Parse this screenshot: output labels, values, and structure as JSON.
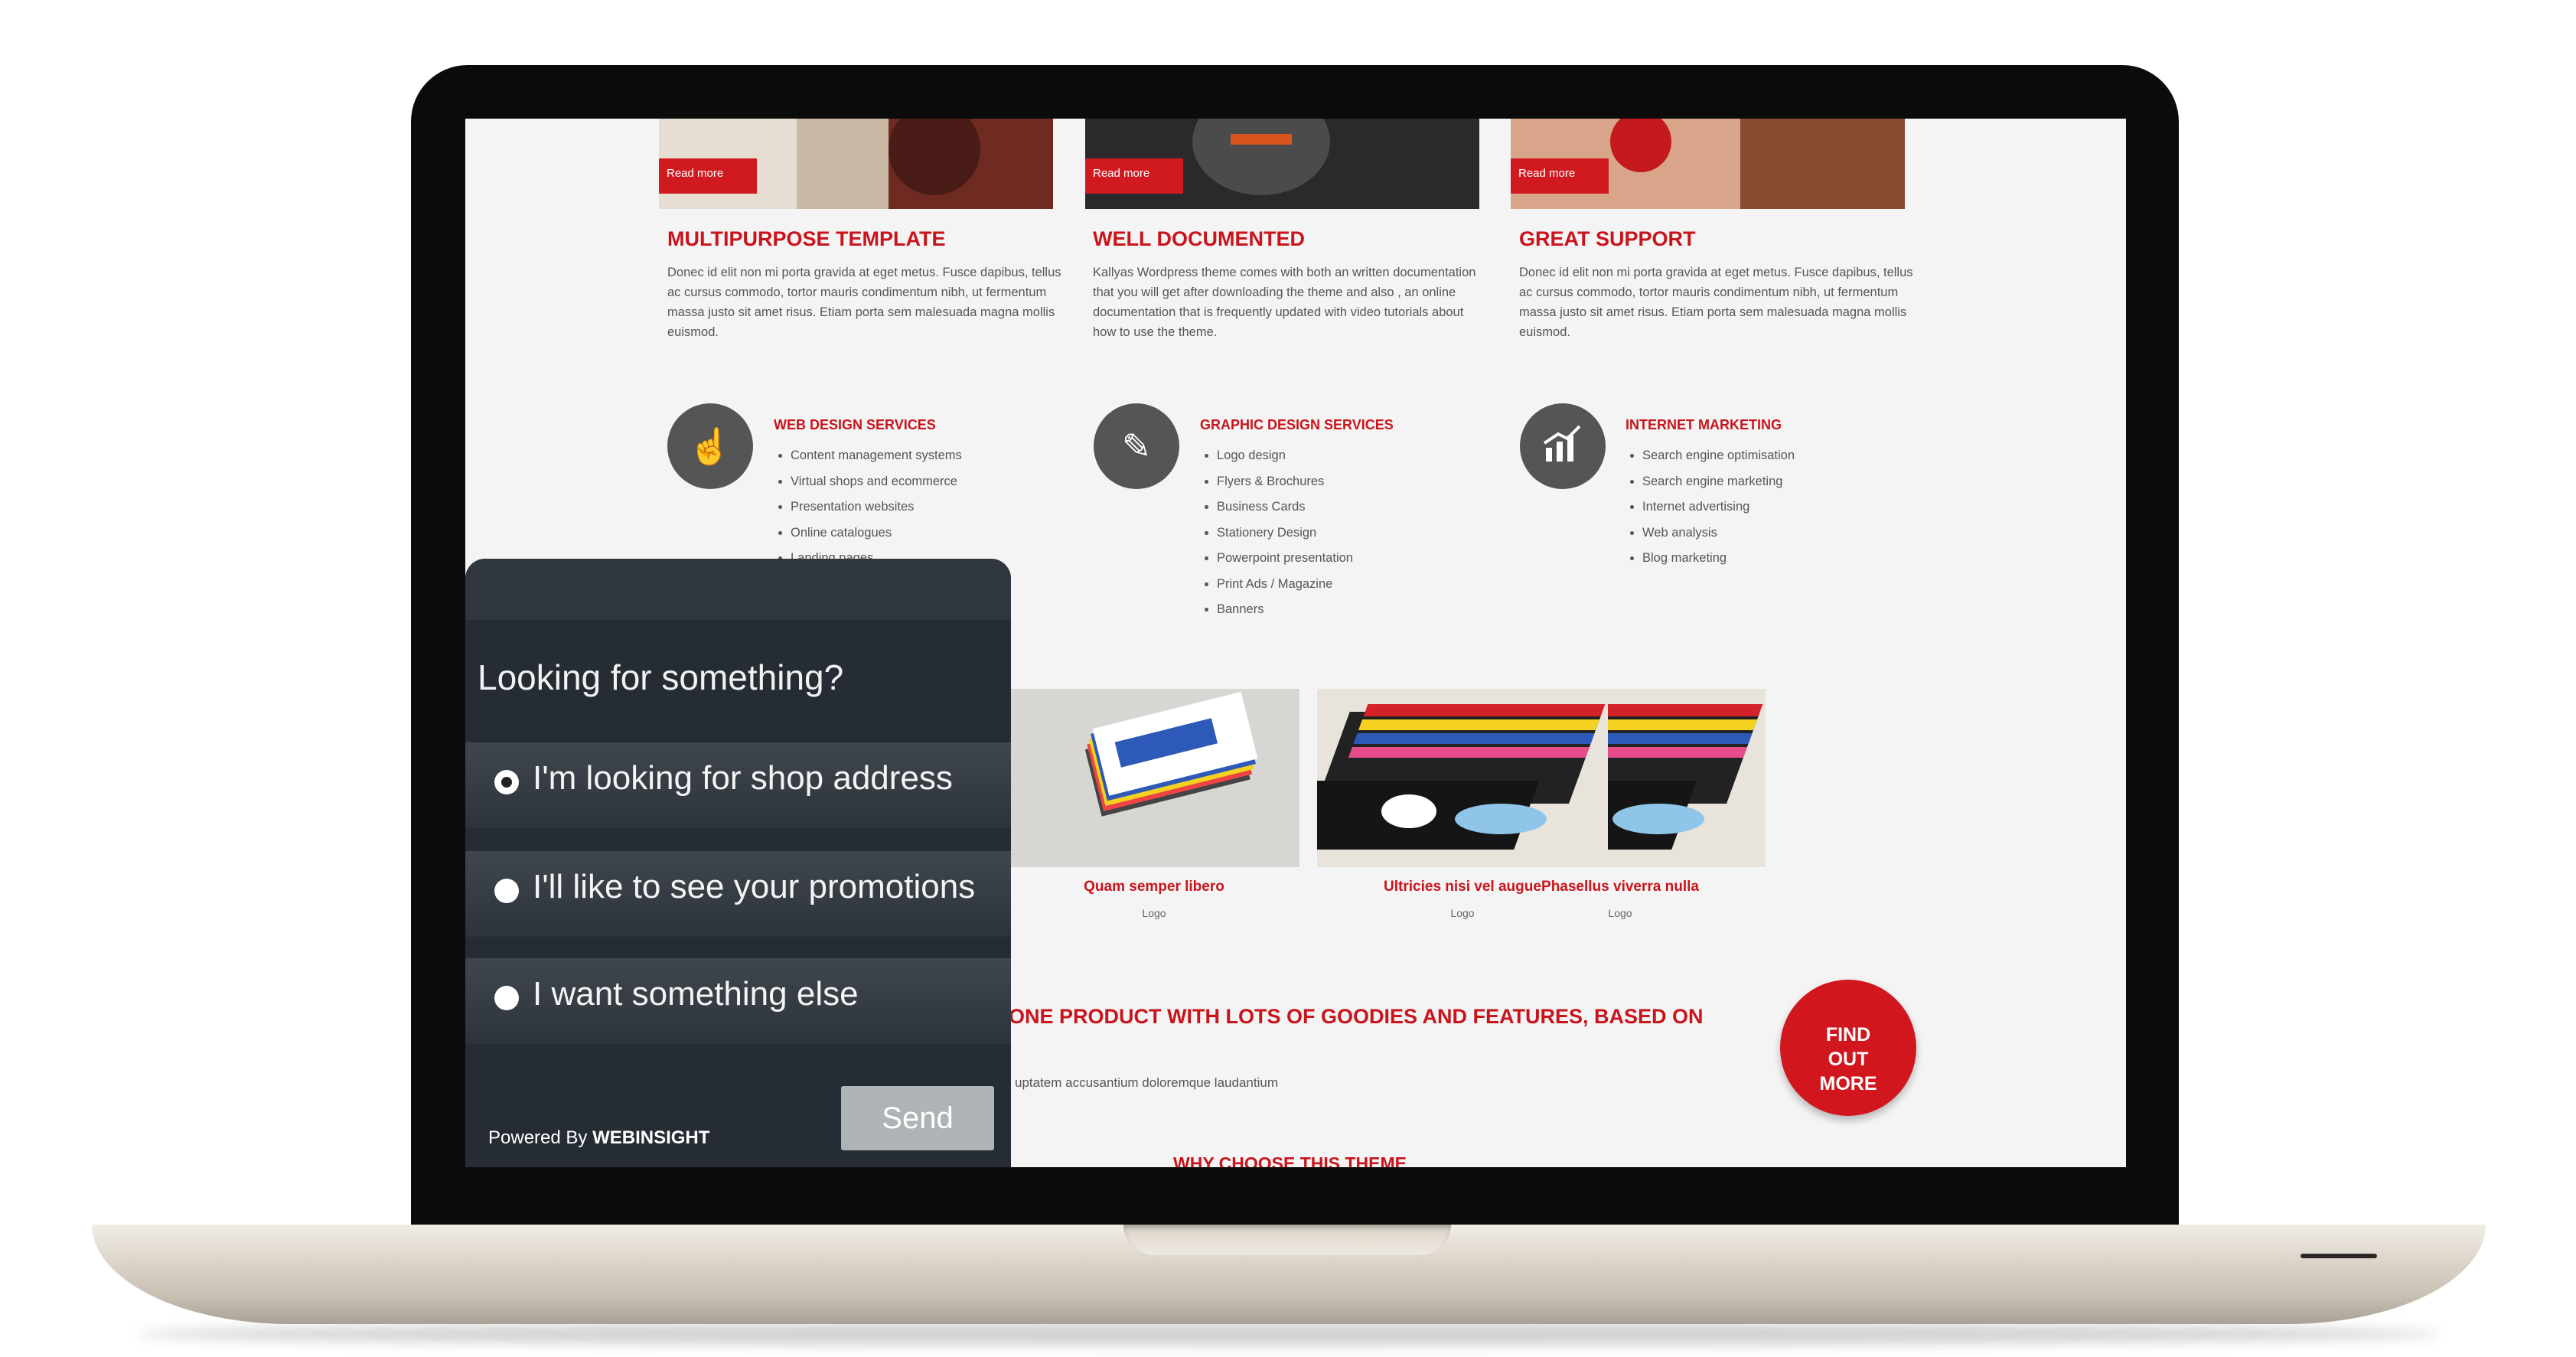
{
  "features": [
    {
      "read_more": "Read more",
      "title": "MULTIPURPOSE TEMPLATE",
      "text": "Donec id elit non mi porta gravida at eget metus. Fusce dapibus, tellus ac cursus commodo, tortor mauris condimentum nibh, ut fermentum massa justo sit amet risus. Etiam porta sem malesuada magna mollis euismod."
    },
    {
      "read_more": "Read more",
      "title": "WELL DOCUMENTED",
      "text": "Kallyas Wordpress theme comes with both an written documentation that you will get after downloading the theme and also , an online documentation that is frequently updated with video tutorials about how to use the theme."
    },
    {
      "read_more": "Read more",
      "title": "GREAT SUPPORT",
      "text": "Donec id elit non mi porta gravida at eget metus. Fusce dapibus, tellus ac cursus commodo, tortor mauris condimentum nibh, ut fermentum massa justo sit amet risus. Etiam porta sem malesuada magna mollis euismod."
    }
  ],
  "services": [
    {
      "icon": "hand-pointer-icon",
      "title": "WEB DESIGN SERVICES",
      "items": [
        "Content management systems",
        "Virtual shops and ecommerce",
        "Presentation websites",
        "Online catalogues",
        "Landing pages"
      ]
    },
    {
      "icon": "paintbrush-icon",
      "title": "GRAPHIC DESIGN SERVICES",
      "items": [
        "Logo design",
        "Flyers & Brochures",
        "Business Cards",
        "Stationery Design",
        "Powerpoint presentation",
        "Print Ads / Magazine",
        "Banners"
      ]
    },
    {
      "icon": "chart-icon",
      "title": "INTERNET MARKETING",
      "items": [
        "Search engine optimisation",
        "Search engine marketing",
        "Internet advertising",
        "Web analysis",
        "Blog marketing"
      ]
    }
  ],
  "portfolio": [
    {
      "title": "Quam semper libero",
      "category": "Logo"
    },
    {
      "title": "Ultricies nisi vel augue",
      "category": "Logo"
    },
    {
      "title": "Phasellus viverra nulla",
      "category": "Logo"
    }
  ],
  "callout": {
    "headline": "ONE PRODUCT WITH LOTS OF GOODIES AND FEATURES, BASED ON",
    "subtext": "uptatem accusantium doloremque laudantium",
    "button": "FIND OUT MORE",
    "section_title": "WHY CHOOSE THIS THEME"
  },
  "widget": {
    "title": "Looking for something?",
    "options": [
      "I'm looking for shop address",
      "I'll like to see your promotions",
      "I want something else"
    ],
    "selected_index": 0,
    "send": "Send",
    "powered_prefix": "Powered By",
    "powered_brand": "WEBINSIGHT"
  },
  "colors": {
    "accent": "#c9141c",
    "widget_bg": "#262c34",
    "send_button": "#aeb4b5"
  }
}
